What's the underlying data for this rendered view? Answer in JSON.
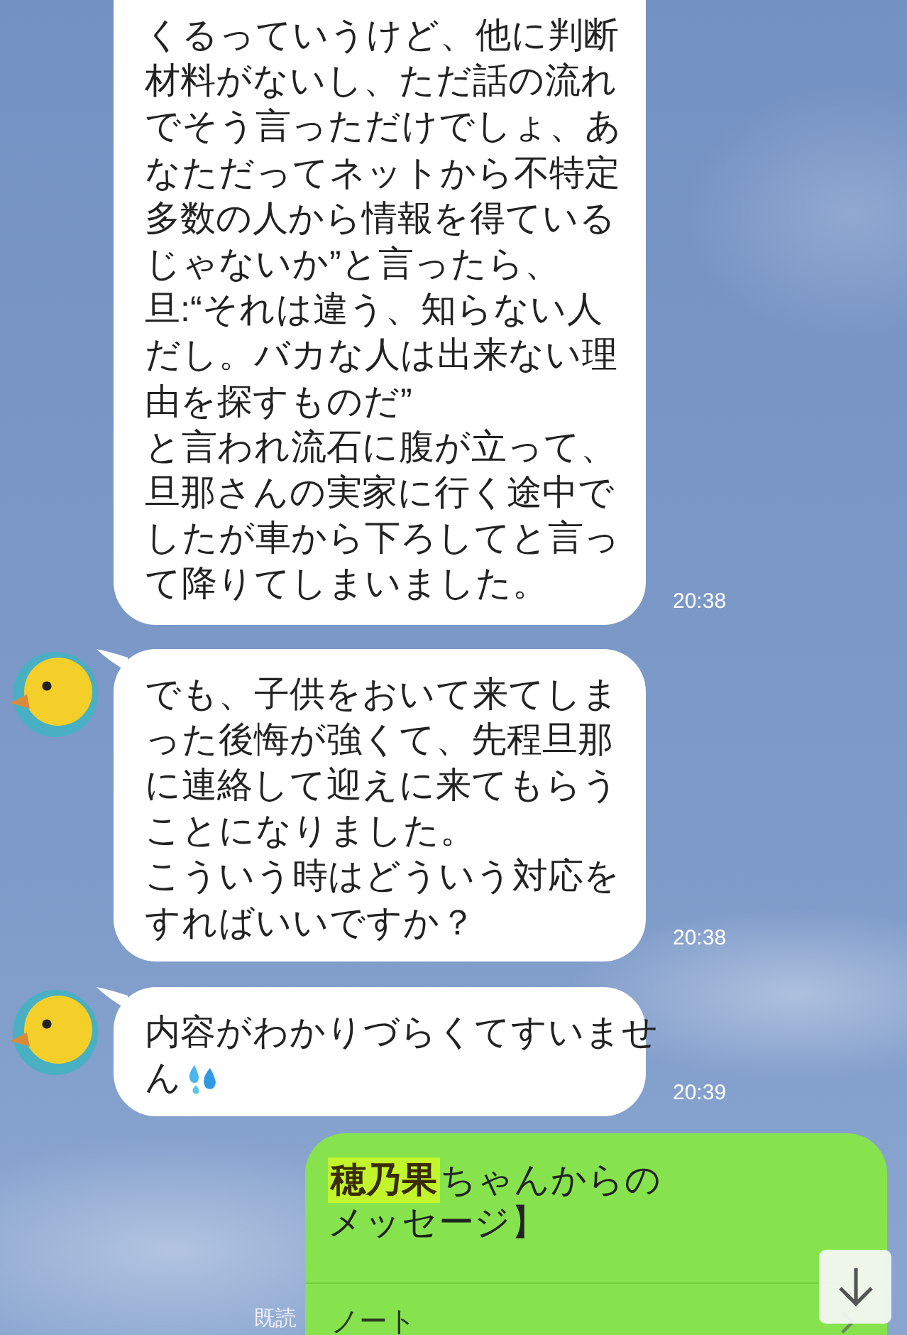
{
  "messages": [
    {
      "kind": "incoming",
      "avatar": false,
      "lines": [
        "くるっていうけど、他に判断",
        "材料がないし、ただ話の流れ",
        "でそう言っただけでしょ、あ",
        "なただってネットから不特定",
        "多数の人から情報を得ている",
        "じゃないか”と言ったら、",
        "旦:“それは違う、知らない人",
        "だし。バカな人は出来ない理",
        "由を探すものだ”",
        "と言われ流石に腹が立って、",
        "旦那さんの実家に行く途中で",
        "したが車から下ろしてと言っ",
        "て降りてしまいました。"
      ],
      "time": "20:38"
    },
    {
      "kind": "incoming",
      "avatar": true,
      "lines": [
        "でも、子供をおいて来てしま",
        "った後悔が強くて、先程旦那",
        "に連絡して迎えに来てもらう",
        "ことになりました。",
        "こういう時はどういう対応を",
        "すればいいですか？"
      ],
      "time": "20:38"
    },
    {
      "kind": "incoming",
      "avatar": true,
      "lines": [
        "内容がわかりづらくてすいませ",
        "ん"
      ],
      "sweat_icon": true,
      "time": "20:39"
    },
    {
      "kind": "outgoing",
      "read_label": "既読",
      "text_lines": [
        [
          {
            "text": "穂乃果",
            "highlighted": true
          },
          {
            "text": "ちゃんからの",
            "highlighted": false
          }
        ],
        [
          {
            "text": "メッセージ】",
            "highlighted": false
          }
        ]
      ],
      "footer": "ノート"
    }
  ],
  "scroll_down_button": true
}
